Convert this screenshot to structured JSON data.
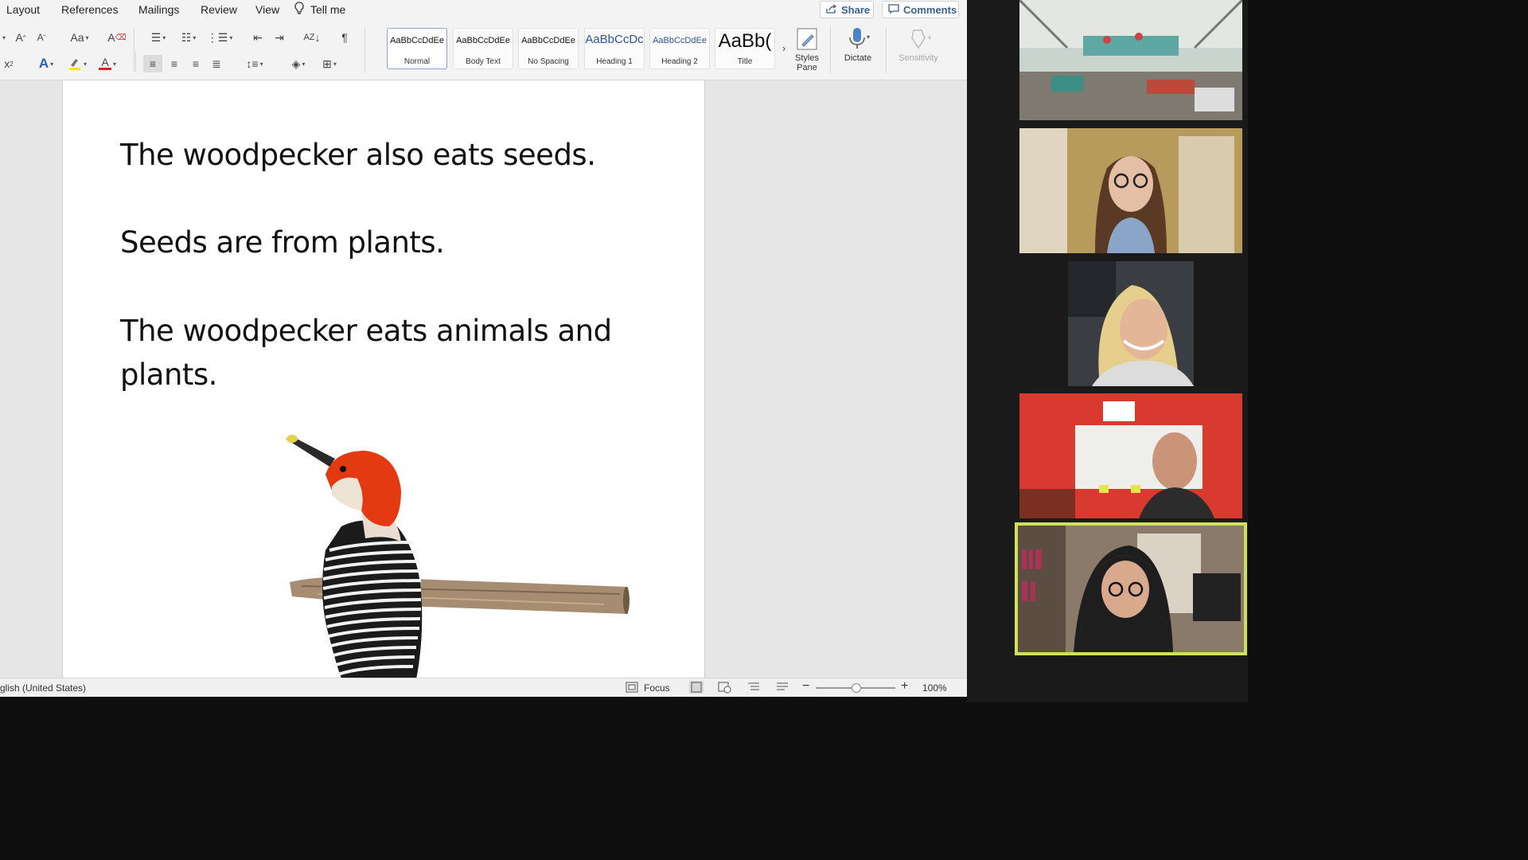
{
  "menubar": {
    "items": [
      "Layout",
      "References",
      "Mailings",
      "Review",
      "View"
    ],
    "tell_me": "Tell me",
    "share": "Share",
    "comments": "Comments"
  },
  "ribbon": {
    "styles": [
      {
        "sample": "AaBbCcDdEe",
        "name": "Normal",
        "selected": true
      },
      {
        "sample": "AaBbCcDdEe",
        "name": "Body Text"
      },
      {
        "sample": "AaBbCcDdEe",
        "name": "No Spacing"
      },
      {
        "sample": "AaBbCcDc",
        "name": "Heading 1"
      },
      {
        "sample": "AaBbCcDdEe",
        "name": "Heading 2"
      },
      {
        "sample": "AaBb(",
        "name": "Title"
      }
    ],
    "styles_pane": "Styles Pane",
    "dictate": "Dictate",
    "sensitivity": "Sensitivity"
  },
  "document": {
    "paragraphs": [
      "The woodpecker also eats seeds.",
      "Seeds are from plants.",
      "The woodpecker eats animals and plants."
    ]
  },
  "statusbar": {
    "language": "glish (United States)",
    "focus": "Focus",
    "zoom": "100%",
    "zoom_level_percent": 100
  },
  "colors": {
    "highlight": "#ffe600",
    "font_color": "#e02020",
    "active_speaker": "#cfe05a"
  }
}
